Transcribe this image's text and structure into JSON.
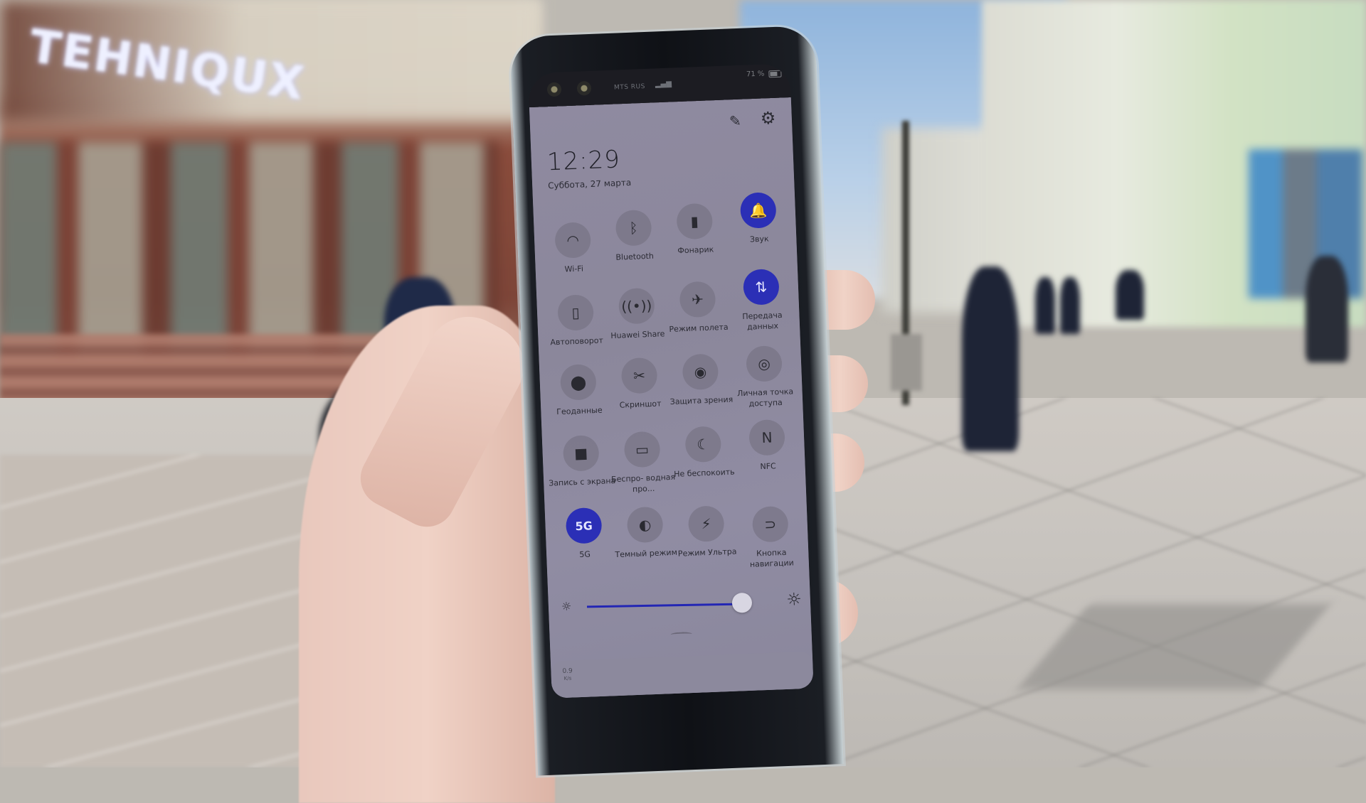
{
  "background": {
    "store_sign": "TEHNIQUX",
    "scene": "blurred pedestrian street"
  },
  "phone": {
    "status_bar": {
      "carrier": "MTS RUS",
      "signal_icon": "signal-bars-icon",
      "battery_percent": "71 %",
      "battery_icon": "battery-icon"
    },
    "header": {
      "edit_icon": "pencil-icon",
      "settings_icon": "gear-icon",
      "time": "12:29",
      "date": "Суббота, 27 марта"
    },
    "accent_color": "#2b2fb6",
    "tiles": [
      {
        "label": "Wi-Fi",
        "icon": "wifi-icon",
        "glyph": "◠",
        "active": false
      },
      {
        "label": "Bluetooth",
        "icon": "bluetooth-icon",
        "glyph": "ᛒ",
        "active": false
      },
      {
        "label": "Фонарик",
        "icon": "flashlight-icon",
        "glyph": "▮",
        "active": false
      },
      {
        "label": "Звук",
        "icon": "bell-icon",
        "glyph": "🔔",
        "active": true
      },
      {
        "label": "Автоповорот",
        "icon": "auto-rotate-icon",
        "glyph": "▯",
        "active": false
      },
      {
        "label": "Huawei Share",
        "icon": "huawei-share-icon",
        "glyph": "((•))",
        "active": false
      },
      {
        "label": "Режим полета",
        "icon": "airplane-icon",
        "glyph": "✈",
        "active": false
      },
      {
        "label": "Передача данных",
        "icon": "mobile-data-icon",
        "glyph": "⇅",
        "active": true
      },
      {
        "label": "Геоданные",
        "icon": "location-pin-icon",
        "glyph": "⬤",
        "active": false
      },
      {
        "label": "Скриншот",
        "icon": "screenshot-scissors-icon",
        "glyph": "✂",
        "active": false
      },
      {
        "label": "Защита зрения",
        "icon": "eye-icon",
        "glyph": "◉",
        "active": false
      },
      {
        "label": "Личная точка доступа",
        "icon": "hotspot-icon",
        "glyph": "◎",
        "active": false
      },
      {
        "label": "Запись с экрана",
        "icon": "screen-record-icon",
        "glyph": "■",
        "active": false
      },
      {
        "label": "Беспро- водная про...",
        "icon": "wireless-projection-icon",
        "glyph": "▭",
        "active": false
      },
      {
        "label": "Не беспокоить",
        "icon": "moon-icon",
        "glyph": "☾",
        "active": false
      },
      {
        "label": "NFC",
        "icon": "nfc-icon",
        "glyph": "N",
        "active": false
      },
      {
        "label": "5G",
        "icon": "5g-icon",
        "glyph": "5G",
        "active": true
      },
      {
        "label": "Темный режим",
        "icon": "dark-mode-icon",
        "glyph": "◐",
        "active": false
      },
      {
        "label": "Режим Ультра",
        "icon": "ultra-battery-icon",
        "glyph": "⚡",
        "active": false
      },
      {
        "label": "Кнопка навигации",
        "icon": "navigation-button-icon",
        "glyph": "⊃",
        "active": false
      }
    ],
    "brightness": {
      "level_percent": 94,
      "low_icon": "sun-small-icon",
      "high_icon": "sun-large-icon"
    },
    "notification": {
      "speed_value": "0.9",
      "speed_unit": "K/s"
    }
  }
}
